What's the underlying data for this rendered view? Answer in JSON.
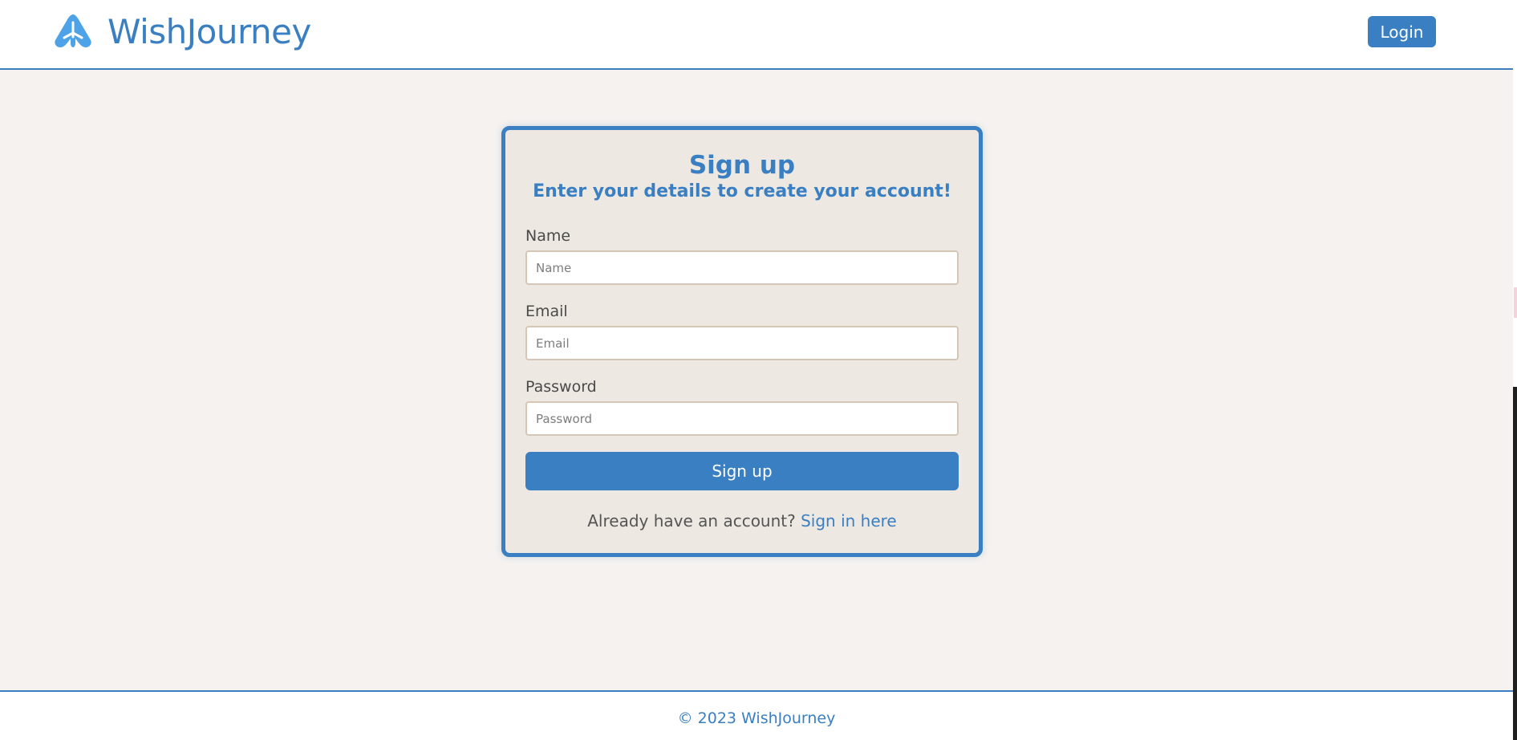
{
  "header": {
    "brand_name": "WishJourney",
    "logo_icon": "airplane-icon",
    "login_label": "Login"
  },
  "signup": {
    "title": "Sign up",
    "subtitle": "Enter your details to create your account!",
    "fields": [
      {
        "label": "Name",
        "placeholder": "Name",
        "value": ""
      },
      {
        "label": "Email",
        "placeholder": "Email",
        "value": ""
      },
      {
        "label": "Password",
        "placeholder": "Password",
        "value": ""
      }
    ],
    "submit_label": "Sign up",
    "signin_prompt": "Already have an account?",
    "signin_link": "Sign in here"
  },
  "footer": {
    "copyright": "© 2023 WishJourney"
  },
  "colors": {
    "accent": "#3a7fc2",
    "page_bg": "#f5f2ef",
    "card_bg": "#ede8e2",
    "input_border": "#d6c6b5"
  }
}
